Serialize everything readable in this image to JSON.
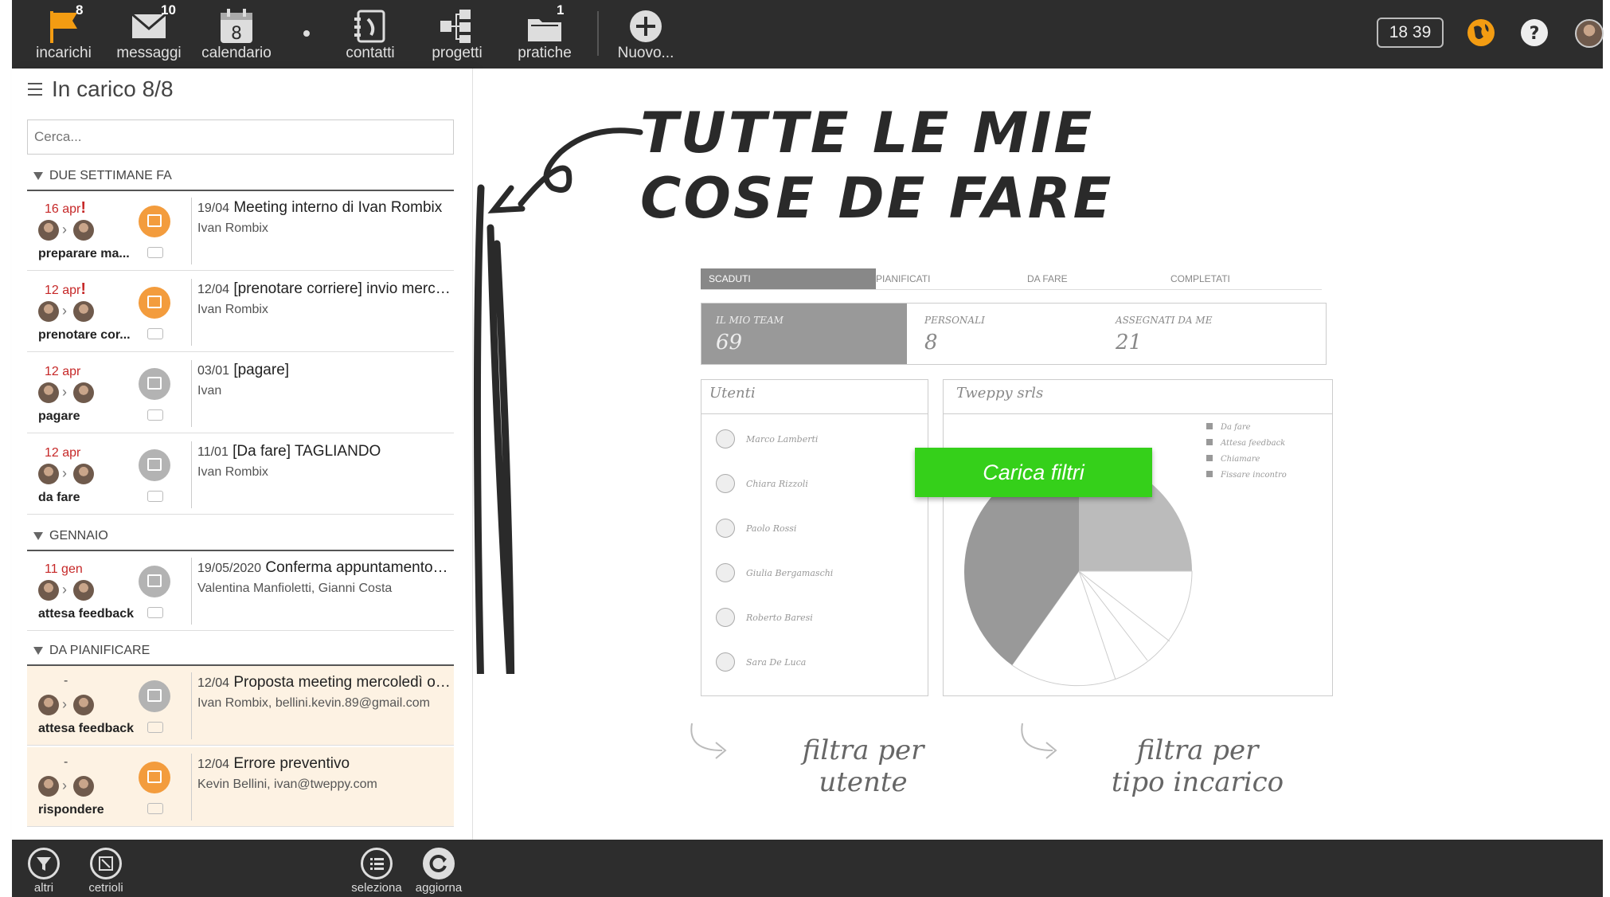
{
  "topbar": {
    "items": [
      {
        "label": "incarichi",
        "badge": "8",
        "icon": "flag-icon"
      },
      {
        "label": "messaggi",
        "badge": "10",
        "icon": "mail-icon"
      },
      {
        "label": "calendario",
        "badge": "",
        "icon": "calendar-icon",
        "day": "8"
      },
      {
        "label": "contatti",
        "badge": "",
        "icon": "contacts-icon"
      },
      {
        "label": "progetti",
        "badge": "",
        "icon": "projects-icon"
      },
      {
        "label": "pratiche",
        "badge": "1",
        "icon": "folder-icon"
      },
      {
        "label": "Nuovo...",
        "badge": "",
        "icon": "plus-icon"
      }
    ],
    "clock": "18 39",
    "accent": "#f39c12"
  },
  "sidebar": {
    "title": "In carico 8/8",
    "search_placeholder": "Cerca...",
    "groups": [
      {
        "label": "DUE SETTIMANE FA"
      },
      {
        "label": "GENNAIO"
      },
      {
        "label": "DA PIANIFICARE"
      }
    ],
    "rows": [
      {
        "date": "16 apr",
        "excl": "!",
        "state": "preparare ma...",
        "t_date": "19/04",
        "title": "Meeting interno di Ivan Rombix",
        "sub": "Ivan Rombix"
      },
      {
        "date": "12 apr",
        "excl": "!",
        "state": "prenotare cor...",
        "t_date": "12/04",
        "title": "[prenotare corriere] invio merce ...",
        "sub": "Ivan Rombix"
      },
      {
        "date": "12 apr",
        "excl": "",
        "state": "pagare",
        "t_date": "03/01",
        "title": "[pagare]",
        "sub": "Ivan"
      },
      {
        "date": "12 apr",
        "excl": "",
        "state": "da fare",
        "t_date": "11/01",
        "title": "[Da fare] TAGLIANDO",
        "sub": "Ivan Rombix"
      },
      {
        "date": "11 gen",
        "excl": "",
        "state": "attesa feedback",
        "t_date": "19/05/2020",
        "title": "Conferma appuntamento p...",
        "sub": "Valentina Manfioletti, Gianni Costa"
      },
      {
        "date": "-",
        "excl": "",
        "state": "attesa feedback",
        "t_date": "12/04",
        "title": "Proposta meeting mercoledì ore...",
        "sub": "Ivan Rombix, bellini.kevin.89@gmail.com"
      },
      {
        "date": "-",
        "excl": "",
        "state": "rispondere",
        "t_date": "12/04",
        "title": "Errore preventivo",
        "sub": "Kevin Bellini, ivan@tweppy.com"
      }
    ]
  },
  "main": {
    "headline_1": "TUTTE LE MIE",
    "headline_2": "COSE DE FARE",
    "sketch_tabs": [
      "SCADUTI",
      "PIANIFICATI",
      "DA FARE",
      "COMPLETATI"
    ],
    "stats": [
      {
        "label": "IL MIO TEAM",
        "value": "69"
      },
      {
        "label": "PERSONALI",
        "value": "8"
      },
      {
        "label": "ASSEGNATI DA ME",
        "value": "21"
      }
    ],
    "users_title": "Utenti",
    "users": [
      "Marco Lamberti",
      "Chiara Rizzoli",
      "Paolo Rossi",
      "Giulia Bergamaschi",
      "Roberto Baresi",
      "Sara De Luca"
    ],
    "company_title": "Tweppy srls",
    "legend": [
      "Da fare",
      "Attesa feedback",
      "Chiamare",
      "Fissare incontro"
    ],
    "cta": "Carica filtri",
    "caption_left_1": "filtra per",
    "caption_left_2": "utente",
    "caption_right_1": "filtra per",
    "caption_right_2": "tipo incarico",
    "cta_color": "#35d01a"
  },
  "bottombar": {
    "items": [
      {
        "label": "altri",
        "icon": "filter-icon"
      },
      {
        "label": "cetrioli",
        "icon": "cetrioli-icon"
      },
      {
        "label": "seleziona",
        "icon": "list-icon"
      },
      {
        "label": "aggiorna",
        "icon": "refresh-icon"
      }
    ]
  }
}
